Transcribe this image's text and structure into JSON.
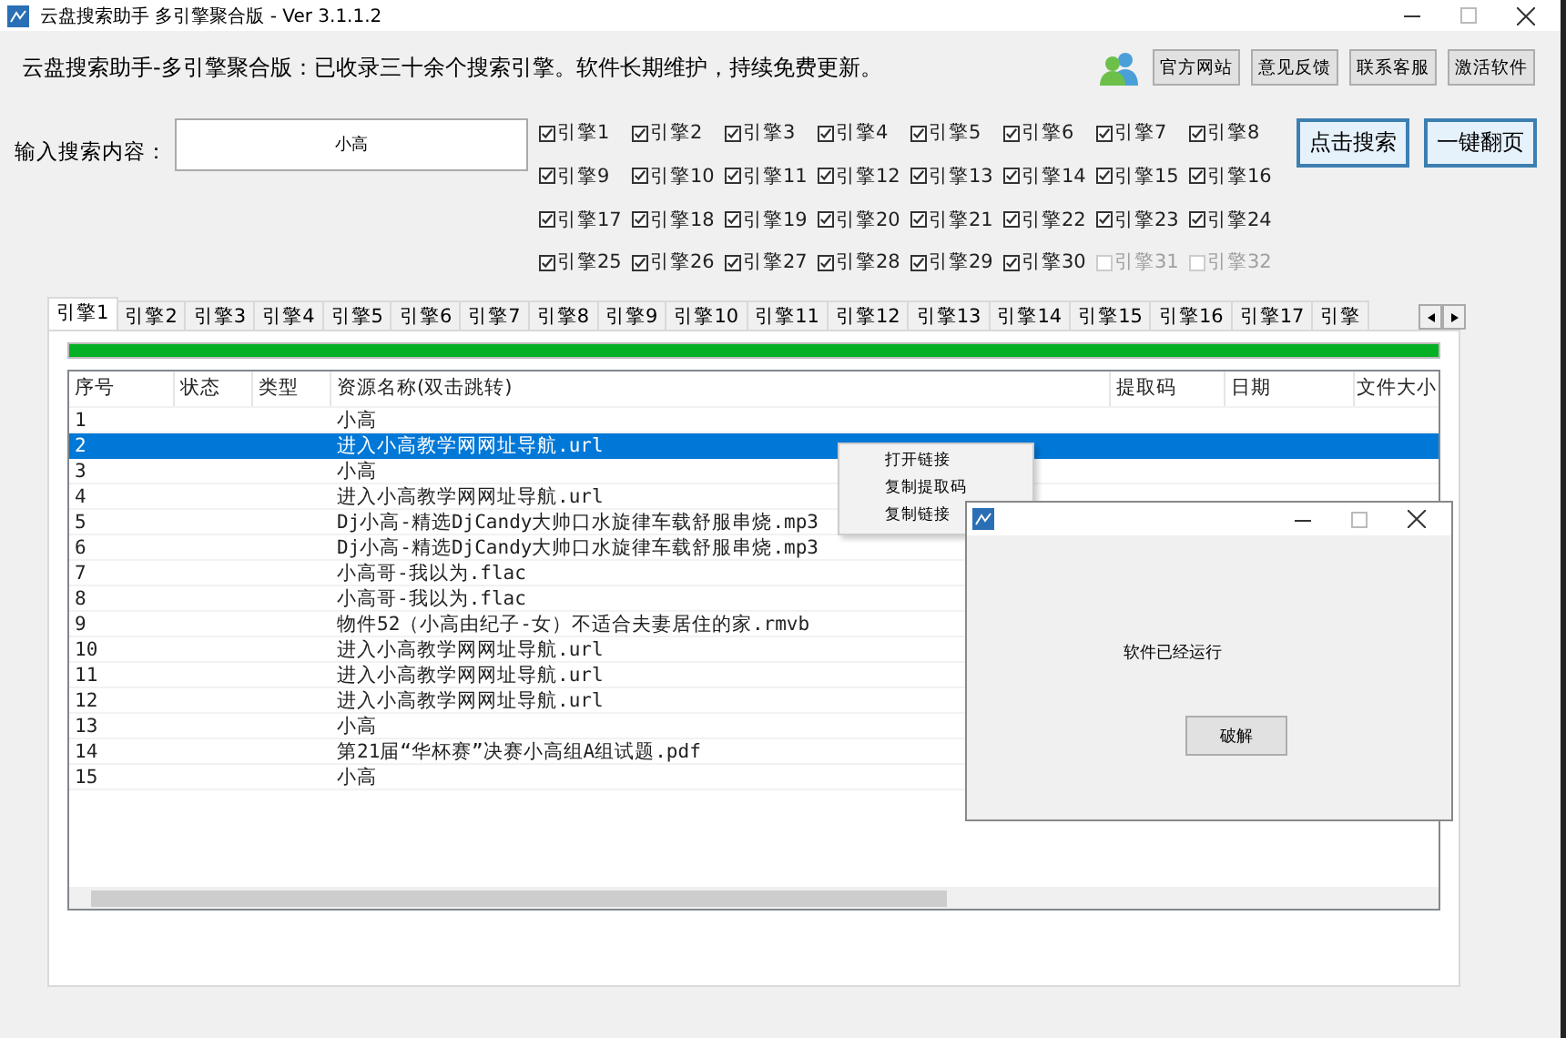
{
  "window": {
    "title": "云盘搜索助手 多引擎聚合版  -  Ver 3.1.1.2"
  },
  "header": {
    "text": "云盘搜索助手-多引擎聚合版：已收录三十余个搜索引擎。软件长期维护，持续免费更新。",
    "buttons": [
      "官方网站",
      "意见反馈",
      "联系客服",
      "激活软件"
    ]
  },
  "search": {
    "label": "输入搜索内容：",
    "value": "小高"
  },
  "engines": [
    {
      "label": "引擎1",
      "checked": true,
      "disabled": false
    },
    {
      "label": "引擎2",
      "checked": true,
      "disabled": false
    },
    {
      "label": "引擎3",
      "checked": true,
      "disabled": false
    },
    {
      "label": "引擎4",
      "checked": true,
      "disabled": false
    },
    {
      "label": "引擎5",
      "checked": true,
      "disabled": false
    },
    {
      "label": "引擎6",
      "checked": true,
      "disabled": false
    },
    {
      "label": "引擎7",
      "checked": true,
      "disabled": false
    },
    {
      "label": "引擎8",
      "checked": true,
      "disabled": false
    },
    {
      "label": "引擎9",
      "checked": true,
      "disabled": false
    },
    {
      "label": "引擎10",
      "checked": true,
      "disabled": false
    },
    {
      "label": "引擎11",
      "checked": true,
      "disabled": false
    },
    {
      "label": "引擎12",
      "checked": true,
      "disabled": false
    },
    {
      "label": "引擎13",
      "checked": true,
      "disabled": false
    },
    {
      "label": "引擎14",
      "checked": true,
      "disabled": false
    },
    {
      "label": "引擎15",
      "checked": true,
      "disabled": false
    },
    {
      "label": "引擎16",
      "checked": true,
      "disabled": false
    },
    {
      "label": "引擎17",
      "checked": true,
      "disabled": false
    },
    {
      "label": "引擎18",
      "checked": true,
      "disabled": false
    },
    {
      "label": "引擎19",
      "checked": true,
      "disabled": false
    },
    {
      "label": "引擎20",
      "checked": true,
      "disabled": false
    },
    {
      "label": "引擎21",
      "checked": true,
      "disabled": false
    },
    {
      "label": "引擎22",
      "checked": true,
      "disabled": false
    },
    {
      "label": "引擎23",
      "checked": true,
      "disabled": false
    },
    {
      "label": "引擎24",
      "checked": true,
      "disabled": false
    },
    {
      "label": "引擎25",
      "checked": true,
      "disabled": false
    },
    {
      "label": "引擎26",
      "checked": true,
      "disabled": false
    },
    {
      "label": "引擎27",
      "checked": true,
      "disabled": false
    },
    {
      "label": "引擎28",
      "checked": true,
      "disabled": false
    },
    {
      "label": "引擎29",
      "checked": true,
      "disabled": false
    },
    {
      "label": "引擎30",
      "checked": true,
      "disabled": false
    },
    {
      "label": "引擎31",
      "checked": false,
      "disabled": true
    },
    {
      "label": "引擎32",
      "checked": false,
      "disabled": true
    }
  ],
  "actions": [
    "点击搜索",
    "一键翻页"
  ],
  "tabs": [
    {
      "label": "引擎1",
      "selected": true
    },
    {
      "label": "引擎2",
      "selected": false
    },
    {
      "label": "引擎3",
      "selected": false
    },
    {
      "label": "引擎4",
      "selected": false
    },
    {
      "label": "引擎5",
      "selected": false
    },
    {
      "label": "引擎6",
      "selected": false
    },
    {
      "label": "引擎7",
      "selected": false
    },
    {
      "label": "引擎8",
      "selected": false
    },
    {
      "label": "引擎9",
      "selected": false
    },
    {
      "label": "引擎10",
      "selected": false
    },
    {
      "label": "引擎11",
      "selected": false
    },
    {
      "label": "引擎12",
      "selected": false
    },
    {
      "label": "引擎13",
      "selected": false
    },
    {
      "label": "引擎14",
      "selected": false
    },
    {
      "label": "引擎15",
      "selected": false
    },
    {
      "label": "引擎16",
      "selected": false
    },
    {
      "label": "引擎17",
      "selected": false
    },
    {
      "label": "引擎",
      "selected": false
    }
  ],
  "progress": {
    "level": 1
  },
  "table": {
    "columns": [
      "序号",
      "状态",
      "类型",
      "资源名称(双击跳转)",
      "提取码",
      "日期",
      "文件大小"
    ],
    "rows": [
      {
        "index": "1",
        "name": "小高",
        "selected": false
      },
      {
        "index": "2",
        "name": "进入小高教学网网址导航.url",
        "selected": true
      },
      {
        "index": "3",
        "name": "小高",
        "selected": false
      },
      {
        "index": "4",
        "name": "进入小高教学网网址导航.url",
        "selected": false
      },
      {
        "index": "5",
        "name": "Dj小高-精选DjCandy大帅口水旋律车载舒服串烧.mp3",
        "selected": false
      },
      {
        "index": "6",
        "name": "Dj小高-精选DjCandy大帅口水旋律车载舒服串烧.mp3",
        "selected": false
      },
      {
        "index": "7",
        "name": "小高哥-我以为.flac",
        "selected": false
      },
      {
        "index": "8",
        "name": "小高哥-我以为.flac",
        "selected": false
      },
      {
        "index": "9",
        "name": "物件52（小高由纪子-女）不适合夫妻居住的家.rmvb",
        "selected": false
      },
      {
        "index": "10",
        "name": "进入小高教学网网址导航.url",
        "selected": false
      },
      {
        "index": "11",
        "name": "进入小高教学网网址导航.url",
        "selected": false
      },
      {
        "index": "12",
        "name": "进入小高教学网网址导航.url",
        "selected": false
      },
      {
        "index": "13",
        "name": "小高",
        "selected": false
      },
      {
        "index": "14",
        "name": "第21届“华杯赛”决赛小高组A组试题.pdf",
        "selected": false
      },
      {
        "index": "15",
        "name": "小高",
        "selected": false
      }
    ]
  },
  "context_menu": [
    "打开链接",
    "复制提取码",
    "复制链接"
  ],
  "dialog": {
    "message": "软件已经运行",
    "button": "破解"
  }
}
